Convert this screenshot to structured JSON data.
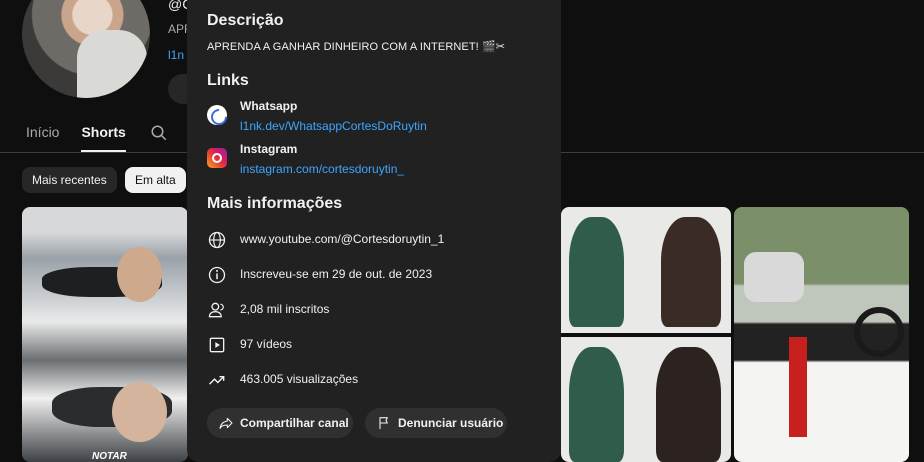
{
  "background": {
    "channel_handle": "@C",
    "channel_desc_preview": "APR",
    "channel_link_preview": "l1n",
    "tabs": [
      {
        "label": "Início",
        "active": false
      },
      {
        "label": "Shorts",
        "active": true
      }
    ],
    "chips": [
      {
        "label": "Mais recentes",
        "selected": false
      },
      {
        "label": "Em alta",
        "selected": true
      }
    ],
    "thumb_caption": "NOTAR"
  },
  "dialog": {
    "description_heading": "Descrição",
    "description_text": "APRENDA A GANHAR DINHEIRO COM A INTERNET! 🎬✂",
    "links_heading": "Links",
    "links": [
      {
        "title": "Whatsapp",
        "url": "l1nk.dev/WhatsappCortesDoRuytin",
        "icon": "whatsapp-icon"
      },
      {
        "title": "Instagram",
        "url": "instagram.com/cortesdoruytin_",
        "icon": "instagram-icon"
      }
    ],
    "more_info_heading": "Mais informações",
    "info": [
      {
        "icon": "globe-icon",
        "text": "www.youtube.com/@Cortesdoruytin_1"
      },
      {
        "icon": "info-icon",
        "text": "Inscreveu-se em 29 de out. de 2023"
      },
      {
        "icon": "subscribers-icon",
        "text": "2,08 mil inscritos"
      },
      {
        "icon": "video-icon",
        "text": "97 vídeos"
      },
      {
        "icon": "trending-icon",
        "text": "463.005 visualizações"
      }
    ],
    "share_button": "Compartilhar canal",
    "report_button": "Denunciar usuário"
  },
  "colors": {
    "page_bg": "#0f0f0f",
    "dialog_bg": "#212121",
    "link": "#3ea6ff",
    "button_bg": "#303030"
  }
}
